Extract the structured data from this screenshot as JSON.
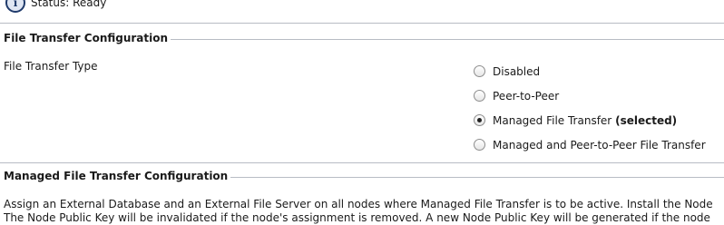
{
  "status": {
    "icon": "info-icon",
    "text": "Status: Ready"
  },
  "file_transfer_config": {
    "title": "File Transfer Configuration",
    "type_label": "File Transfer Type",
    "options": [
      {
        "label": "Disabled",
        "suffix": "",
        "checked": false
      },
      {
        "label": "Peer-to-Peer",
        "suffix": "",
        "checked": false
      },
      {
        "label": "Managed File Transfer",
        "suffix": "(selected)",
        "checked": true
      },
      {
        "label": "Managed and Peer-to-Peer File Transfer",
        "suffix": "",
        "checked": false
      }
    ]
  },
  "managed_config": {
    "title": "Managed File Transfer Configuration",
    "line1": "Assign an External Database and an External File Server on all nodes where Managed File Transfer is to be active. Install the Node",
    "line2": "The Node Public Key will be invalidated if the node's assignment is removed. A new Node Public Key will be generated if the node"
  }
}
